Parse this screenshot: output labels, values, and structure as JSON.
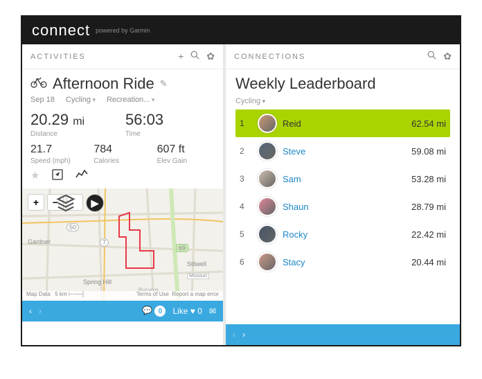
{
  "brand": {
    "name": "connect",
    "sub": "powered by Garmin"
  },
  "activities": {
    "panel_title": "ACTIVITIES",
    "title": "Afternoon Ride",
    "date": "Sep 18",
    "type": "Cycling",
    "category": "Recreation...",
    "distance": {
      "value": "20.29",
      "unit": "mi",
      "label": "Distance"
    },
    "time": {
      "value": "56:03",
      "label": "Time"
    },
    "speed": {
      "value": "21.7",
      "label": "Speed (mph)"
    },
    "calories": {
      "value": "784",
      "label": "Calories"
    },
    "elev": {
      "value": "607 ft",
      "label": "Elev Gain"
    },
    "map": {
      "scale": "5 km",
      "data_label": "Map Data",
      "terms": "Terms of Use",
      "report": "Report a map error",
      "places": {
        "gardner": "Gardner",
        "spring": "Spring Hill",
        "stilwell": "Stilwell",
        "missouri": "Missouri",
        "bucyrus": "Bucyrus"
      },
      "roads": {
        "r50": "50",
        "r7": "7",
        "r69": "69"
      }
    },
    "social": {
      "comments": "0",
      "like_label": "Like",
      "likes": "0"
    }
  },
  "connections": {
    "panel_title": "CONNECTIONS",
    "title": "Weekly Leaderboard",
    "filter": "Cycling",
    "rows": [
      {
        "rank": "1",
        "name": "Reid",
        "dist": "62.54 mi",
        "hl": true
      },
      {
        "rank": "2",
        "name": "Steve",
        "dist": "59.08 mi"
      },
      {
        "rank": "3",
        "name": "Sam",
        "dist": "53.28 mi"
      },
      {
        "rank": "4",
        "name": "Shaun",
        "dist": "28.79 mi"
      },
      {
        "rank": "5",
        "name": "Rocky",
        "dist": "22.42 mi"
      },
      {
        "rank": "6",
        "name": "Stacy",
        "dist": "20.44 mi"
      }
    ]
  }
}
